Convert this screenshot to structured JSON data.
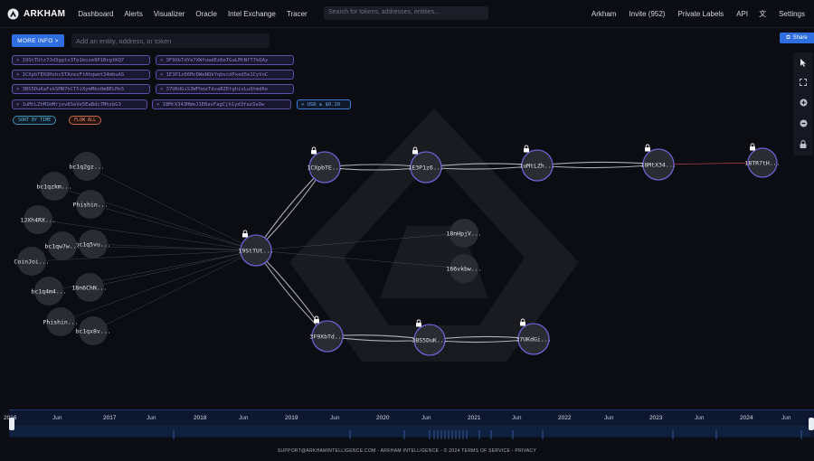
{
  "header": {
    "brand": "ARKHAM",
    "nav": [
      "Dashboard",
      "Alerts",
      "Visualizer",
      "Oracle",
      "Intel Exchange",
      "Tracer"
    ],
    "search_placeholder": "Search for tokens, addresses, entities...",
    "right_nav": [
      "Arkham",
      "Invite (952)",
      "Private Labels",
      "API",
      "Settings"
    ]
  },
  "toolbar": {
    "more_info_label": "MORE INFO >",
    "entity_placeholder": "Add an entity, address, or token",
    "share_label": "Share"
  },
  "filters": {
    "tags": [
      "19StTUtz7Jd3ggtz3Tp1koze9P1BvgtKQ7",
      "3F9XbTdYe7XWfuwdEzKeTGuLMtNfT7kQAy",
      "1CXpbTE6QHxhc5TAzezFtAhqwmt34mbuAS",
      "1E3P1z66McDWeNQkYqbvcdPxed5e1CyVoC",
      "3BS5DuKaFskSMN7hCT5iXymMko0mBELMx5",
      "37UKdGiS3WFhmzTdvaBZEtghivLuQtmdKe",
      "1uMtLZhM1mMrjev8SeVe5EaBdc7MhzbG3",
      "18MtX343HWeJ1EBasFagCjh1yd3fazSu9w"
    ],
    "usd_filter": "USD ≥ $0.10",
    "sort_label": "SORT BY TIME",
    "flow_label": "FLOW ALL"
  },
  "graph": {
    "nodes": [
      {
        "label": "19StTUt...",
        "locked": true
      },
      {
        "label": "1CXpbTE...",
        "locked": true
      },
      {
        "label": "1E3P1z6...",
        "locked": true
      },
      {
        "label": "1uMtLZh...",
        "locked": true
      },
      {
        "label": "18MtX34...",
        "locked": true
      },
      {
        "label": "18TR7tH...",
        "locked": true
      },
      {
        "label": "3F9XbTd...",
        "locked": true
      },
      {
        "label": "3BS5DuK...",
        "locked": true
      },
      {
        "label": "37UKdGi...",
        "locked": true
      },
      {
        "label": "18nHpjV...",
        "locked": false
      },
      {
        "label": "166vkbw...",
        "locked": false
      },
      {
        "label": "bc1q2gz...",
        "locked": false
      },
      {
        "label": "bc1qzkm...",
        "locked": false
      },
      {
        "label": "Phishin...",
        "locked": false
      },
      {
        "label": "1JXh4RX...",
        "locked": false
      },
      {
        "label": "bc1q5vu...",
        "locked": false
      },
      {
        "label": "bc1qw7w...",
        "locked": false
      },
      {
        "label": "CoinJoi...",
        "locked": false
      },
      {
        "label": "18n6ChN...",
        "locked": false
      },
      {
        "label": "bc1q4m4...",
        "locked": false
      },
      {
        "label": "Phishin...",
        "locked": false
      },
      {
        "label": "bc1qx8v...",
        "locked": false
      }
    ]
  },
  "timeline": {
    "labels": [
      {
        "text": "2016",
        "year": true
      },
      {
        "text": "Jun",
        "year": false
      },
      {
        "text": "2017",
        "year": true
      },
      {
        "text": "Jun",
        "year": false
      },
      {
        "text": "2018",
        "year": true
      },
      {
        "text": "Jun",
        "year": false
      },
      {
        "text": "2019",
        "year": true
      },
      {
        "text": "Jun",
        "year": false
      },
      {
        "text": "2020",
        "year": true
      },
      {
        "text": "Jun",
        "year": false
      },
      {
        "text": "2021",
        "year": true
      },
      {
        "text": "Jun",
        "year": false
      },
      {
        "text": "2022",
        "year": true
      },
      {
        "text": "Jun",
        "year": false
      },
      {
        "text": "2023",
        "year": true
      },
      {
        "text": "Jun",
        "year": false
      },
      {
        "text": "2024",
        "year": true
      },
      {
        "text": "Jun",
        "year": false
      }
    ]
  },
  "footer": {
    "text": "SUPPORT@ARKHAMINTELLIGENCE.COM - ARKHAM INTELLIGENCE - © 2024  TERMS OF SERVICE - PRIVACY"
  },
  "colors": {
    "accent": "#2f6ee0",
    "node_fill": "#2a2c33",
    "tracked_ring": "#6f5fd0",
    "edge": "#c9cbd2"
  }
}
